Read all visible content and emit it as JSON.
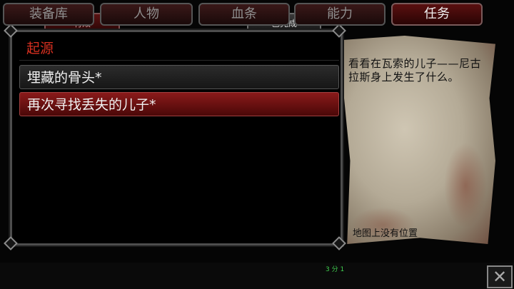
{
  "tabs": {
    "active_label": "有效",
    "completed_label": "已完成"
  },
  "quest_list": {
    "header": "起源",
    "items": [
      {
        "label": "埋藏的骨头*"
      },
      {
        "label": "再次寻找丢失的儿子*"
      }
    ]
  },
  "quest_detail": {
    "description": "看看在瓦索的儿子——尼古拉斯身上发生了什么。",
    "map_note": "地图上没有位置"
  },
  "bottom_nav": {
    "items": [
      "装备库",
      "人物",
      "血条",
      "能力",
      "任务"
    ],
    "ability_counter": "3 分 1",
    "close_icon": "close-icon"
  },
  "colors": {
    "header_red": "#d83020",
    "selected_row": "#8a1a1a",
    "counter_green": "#40d050"
  }
}
